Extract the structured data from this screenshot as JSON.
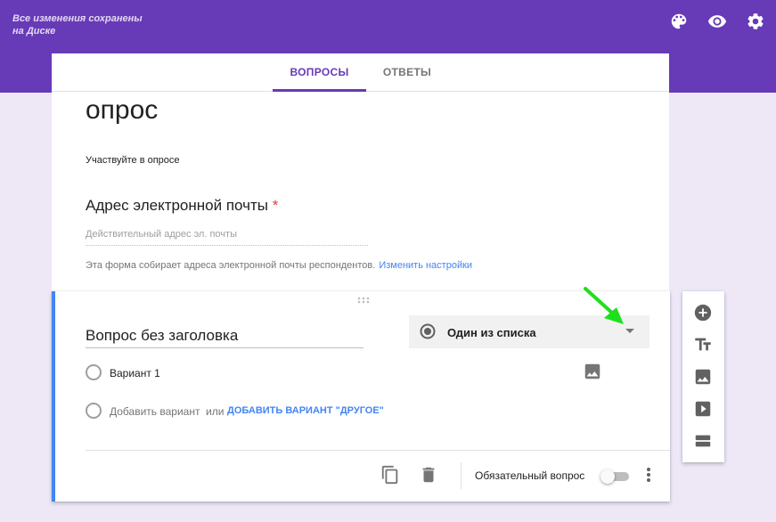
{
  "header": {
    "save_status": "Все изменения сохранены на Диске",
    "icons": [
      "palette-icon",
      "eye-icon",
      "gear-icon"
    ],
    "color": "#673ab7"
  },
  "tabs": [
    {
      "label": "ВОПРОСЫ",
      "active": true
    },
    {
      "label": "ОТВЕТЫ",
      "active": false
    }
  ],
  "form": {
    "title": "опрос",
    "description": "Участвуйте в опросе",
    "email_question": {
      "label": "Адрес электронной почты",
      "required_mark": "*",
      "placeholder": "Действительный адрес эл. почты"
    },
    "collect_note": "Эта форма собирает адреса электронной почты респондентов.",
    "collect_link": "Изменить настройки"
  },
  "question": {
    "title": "Вопрос без заголовка",
    "type": "Один из списка",
    "options": [
      "Вариант 1"
    ],
    "add_option": "Добавить вариант",
    "or": "или",
    "add_other": "ДОБАВИТЬ ВАРИАНТ \"ДРУГОЕ\"",
    "required_label": "Обязательный вопрос",
    "required": false,
    "accent_color": "#4285f4"
  },
  "side_toolbar": [
    "add-question-icon",
    "add-title-icon",
    "add-image-icon",
    "add-video-icon",
    "add-section-icon"
  ],
  "annotation": {
    "arrow_color": "#1de01d"
  }
}
